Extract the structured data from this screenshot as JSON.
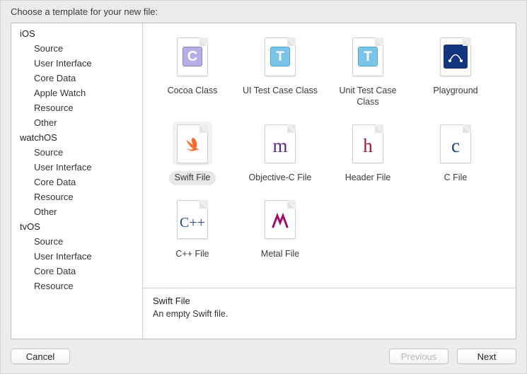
{
  "prompt": "Choose a template for your new file:",
  "sidebar": [
    {
      "platform": "iOS",
      "items": [
        "Source",
        "User Interface",
        "Core Data",
        "Apple Watch",
        "Resource",
        "Other"
      ]
    },
    {
      "platform": "watchOS",
      "items": [
        "Source",
        "User Interface",
        "Core Data",
        "Resource",
        "Other"
      ]
    },
    {
      "platform": "tvOS",
      "items": [
        "Source",
        "User Interface",
        "Core Data",
        "Resource"
      ]
    }
  ],
  "templates": [
    {
      "label": "Cocoa Class",
      "icon": "c-box-icon",
      "selected": false
    },
    {
      "label": "UI Test Case Class",
      "icon": "t-box-icon",
      "selected": false
    },
    {
      "label": "Unit Test Case Class",
      "icon": "t-box-icon",
      "selected": false
    },
    {
      "label": "Playground",
      "icon": "playground-icon",
      "selected": false
    },
    {
      "label": "Swift File",
      "icon": "swift-icon",
      "selected": true
    },
    {
      "label": "Objective-C File",
      "icon": "m-file-icon",
      "selected": false
    },
    {
      "label": "Header File",
      "icon": "h-file-icon",
      "selected": false
    },
    {
      "label": "C File",
      "icon": "c-file-icon",
      "selected": false
    },
    {
      "label": "C++ File",
      "icon": "cpp-file-icon",
      "selected": false
    },
    {
      "label": "Metal File",
      "icon": "metal-file-icon",
      "selected": false
    }
  ],
  "detail": {
    "title": "Swift File",
    "description": "An empty Swift file."
  },
  "buttons": {
    "cancel": "Cancel",
    "previous": "Previous",
    "next": "Next"
  }
}
